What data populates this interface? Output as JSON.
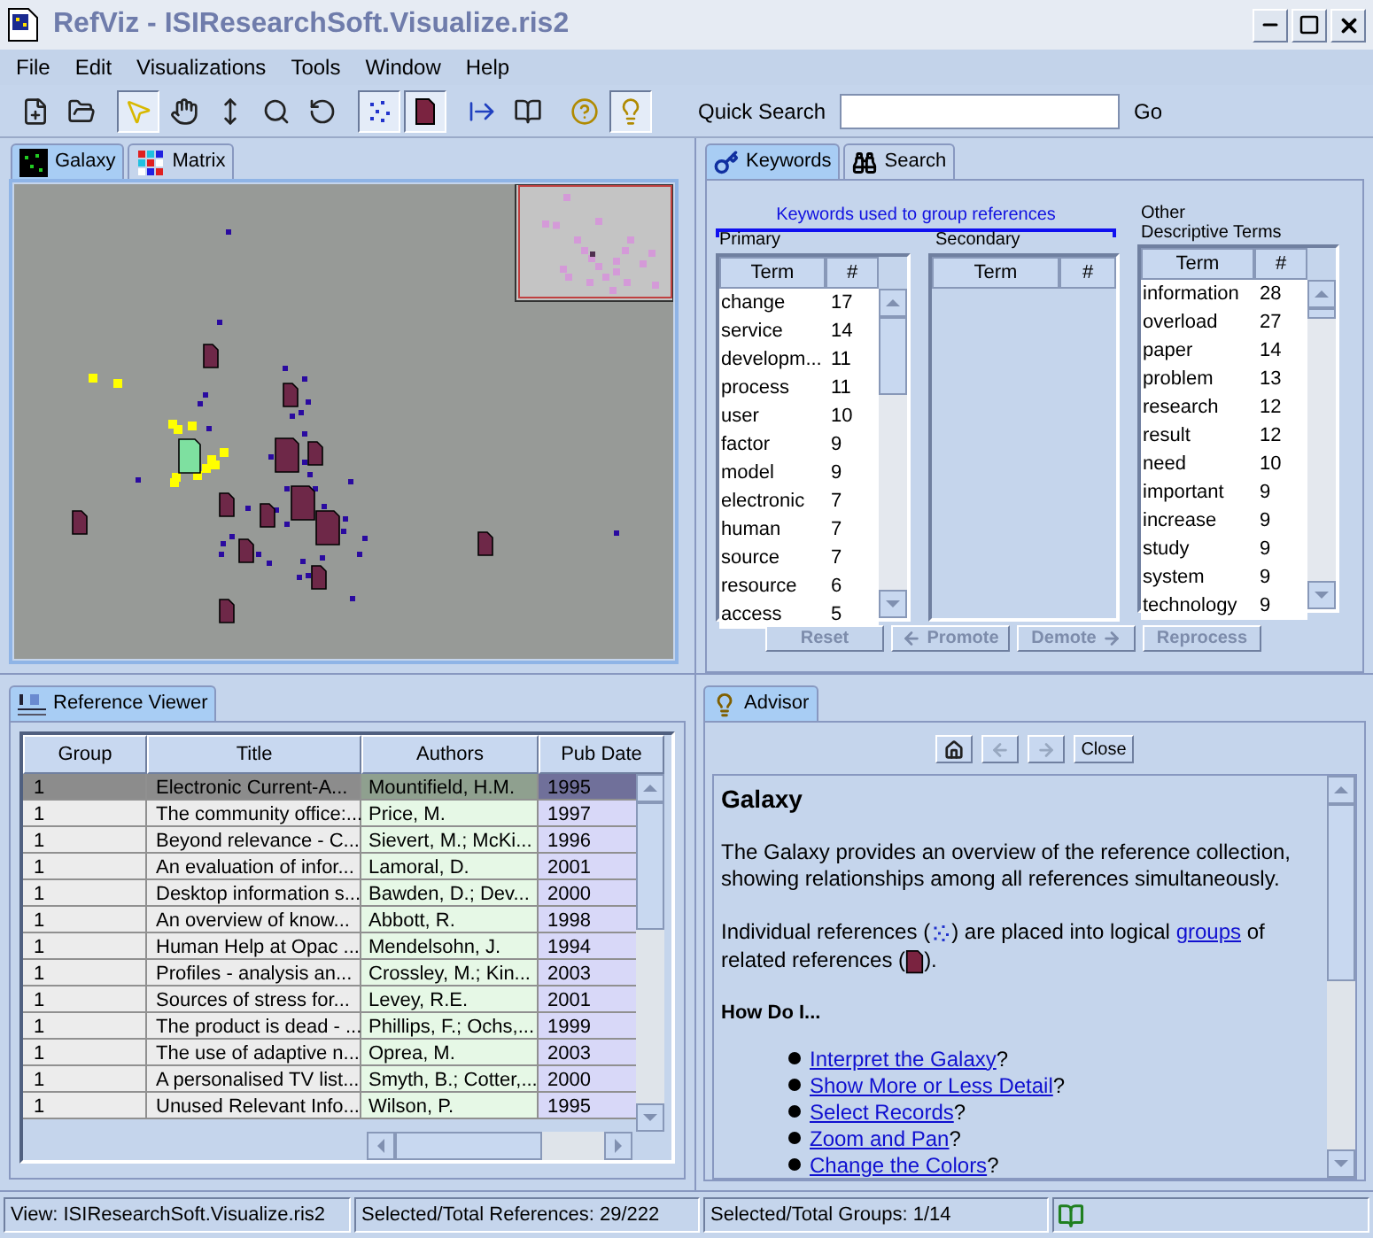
{
  "window": {
    "title": "RefViz - ISIResearchSoft.Visualize.ris2"
  },
  "menu": [
    "File",
    "Edit",
    "Visualizations",
    "Tools",
    "Window",
    "Help"
  ],
  "toolbar": [
    [
      {
        "kind": "new",
        "selected": false
      },
      {
        "kind": "open",
        "selected": false
      }
    ],
    [
      {
        "kind": "pointer",
        "selected": true
      },
      {
        "kind": "pan",
        "selected": false
      },
      {
        "kind": "move",
        "selected": false
      },
      {
        "kind": "zoom",
        "selected": false
      },
      {
        "kind": "rotate",
        "selected": false
      }
    ],
    [
      {
        "kind": "dots",
        "selected": true
      },
      {
        "kind": "document",
        "selected": true
      }
    ],
    [
      {
        "kind": "export",
        "selected": false
      },
      {
        "kind": "book",
        "selected": false
      }
    ],
    [
      {
        "kind": "help",
        "selected": false
      },
      {
        "kind": "tip",
        "selected": true
      }
    ]
  ],
  "quick_search": {
    "label": "Quick Search",
    "button": "Go"
  },
  "view_tabs": [
    {
      "kind": "galaxy",
      "label": "Galaxy",
      "selected": true
    },
    {
      "kind": "matrix",
      "label": "Matrix",
      "selected": false
    }
  ],
  "keywords": {
    "tabs": [
      {
        "kind": "key",
        "label": "Keywords",
        "selected": true
      },
      {
        "kind": "binoculars",
        "label": "Search",
        "selected": false
      }
    ],
    "heading": "Keywords used to group references",
    "primary": {
      "label": "Primary",
      "columns": [
        "Term",
        "#"
      ],
      "rows": [
        [
          "change",
          "17"
        ],
        [
          "service",
          "14"
        ],
        [
          "developm...",
          "11"
        ],
        [
          "process",
          "11"
        ],
        [
          "user",
          "10"
        ],
        [
          "factor",
          "9"
        ],
        [
          "model",
          "9"
        ],
        [
          "electronic",
          "7"
        ],
        [
          "human",
          "7"
        ],
        [
          "source",
          "7"
        ],
        [
          "resource",
          "6"
        ],
        [
          "access",
          "5"
        ]
      ]
    },
    "secondary": {
      "label": "Secondary",
      "columns": [
        "Term",
        "#"
      ]
    },
    "other": {
      "label_lines": [
        "Other",
        "Descriptive Terms"
      ],
      "columns": [
        "Term",
        "#"
      ],
      "rows": [
        [
          "information",
          "28"
        ],
        [
          "overload",
          "27"
        ],
        [
          "paper",
          "14"
        ],
        [
          "problem",
          "13"
        ],
        [
          "research",
          "12"
        ],
        [
          "result",
          "12"
        ],
        [
          "need",
          "10"
        ],
        [
          "important",
          "9"
        ],
        [
          "increase",
          "9"
        ],
        [
          "study",
          "9"
        ],
        [
          "system",
          "9"
        ],
        [
          "technology",
          "9"
        ]
      ]
    },
    "buttons": [
      {
        "kind": "plain",
        "label": "Reset",
        "disabled": true
      },
      {
        "kind": "promote",
        "label": "Promote",
        "disabled": true
      },
      {
        "kind": "demote",
        "label": "Demote",
        "disabled": true
      },
      {
        "kind": "plain",
        "label": "Reprocess",
        "disabled": true
      }
    ]
  },
  "reference_viewer": {
    "tab": "Reference Viewer",
    "columns": [
      "Group",
      "Title",
      "Authors",
      "Pub Date"
    ],
    "rows": [
      {
        "group": "1",
        "title": "Electronic Current-A...",
        "authors": "Mountifield, H.M.",
        "pub_date": "1995",
        "selected": true
      },
      {
        "group": "1",
        "title": "The community office:...",
        "authors": "Price, M.",
        "pub_date": "1997",
        "selected": false
      },
      {
        "group": "1",
        "title": "Beyond relevance - C...",
        "authors": "Sievert, M.; McKi...",
        "pub_date": "1996",
        "selected": false
      },
      {
        "group": "1",
        "title": "An evaluation of infor...",
        "authors": "Lamoral, D.",
        "pub_date": "2001",
        "selected": false
      },
      {
        "group": "1",
        "title": "Desktop information s...",
        "authors": "Bawden, D.; Dev...",
        "pub_date": "2000",
        "selected": false
      },
      {
        "group": "1",
        "title": "An overview of know...",
        "authors": "Abbott, R.",
        "pub_date": "1998",
        "selected": false
      },
      {
        "group": "1",
        "title": "Human Help at Opac ...",
        "authors": "Mendelsohn, J.",
        "pub_date": "1994",
        "selected": false
      },
      {
        "group": "1",
        "title": "Profiles - analysis an...",
        "authors": "Crossley, M.; Kin...",
        "pub_date": "2003",
        "selected": false
      },
      {
        "group": "1",
        "title": "Sources of stress for...",
        "authors": "Levey, R.E.",
        "pub_date": "2001",
        "selected": false
      },
      {
        "group": "1",
        "title": "The product is dead - ...",
        "authors": "Phillips, F.; Ochs,...",
        "pub_date": "1999",
        "selected": false
      },
      {
        "group": "1",
        "title": "The use of adaptive n...",
        "authors": "Oprea, M.",
        "pub_date": "2003",
        "selected": false
      },
      {
        "group": "1",
        "title": "A personalised TV list...",
        "authors": "Smyth, B.; Cotter,...",
        "pub_date": "2000",
        "selected": false
      },
      {
        "group": "1",
        "title": "Unused Relevant Info...",
        "authors": "Wilson, P.",
        "pub_date": "1995",
        "selected": false
      }
    ]
  },
  "advisor": {
    "tab": "Advisor",
    "nav": [
      {
        "kind": "home",
        "disabled": false
      },
      {
        "kind": "back",
        "disabled": true
      },
      {
        "kind": "forward",
        "disabled": true
      }
    ],
    "close_button": "Close",
    "title": "Galaxy",
    "intro": "The Galaxy provides an overview of the reference collection, showing relationships among all references simultaneously.",
    "segments": [
      {
        "kind": "text",
        "text": "Individual references ("
      },
      {
        "kind": "dots"
      },
      {
        "kind": "text",
        "text": ") are placed into logical "
      },
      {
        "kind": "link",
        "text": "groups"
      },
      {
        "kind": "text",
        "text": " of related references ("
      },
      {
        "kind": "document"
      },
      {
        "kind": "text",
        "text": ")."
      }
    ],
    "how_heading": "How Do I...",
    "links": [
      {
        "link": "Interpret the Galaxy",
        "suffix": "?"
      },
      {
        "link": "Show More or Less Detail",
        "suffix": "?"
      },
      {
        "link": "Select Records",
        "suffix": "?"
      },
      {
        "link": "Zoom and Pan",
        "suffix": "?"
      },
      {
        "link": "Change the Colors",
        "suffix": "?"
      }
    ]
  },
  "status_bar": [
    "View: ISIResearchSoft.Visualize.ris2",
    "Selected/Total References: 29/222",
    "Selected/Total Groups: 1/14"
  ]
}
